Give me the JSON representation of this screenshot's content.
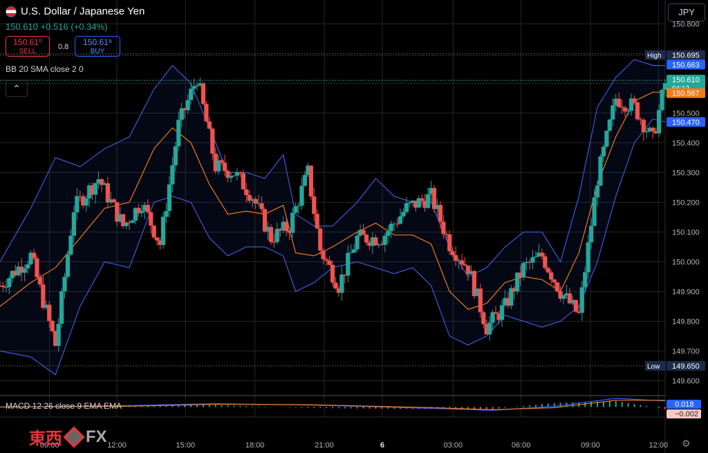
{
  "header": {
    "symbol_name": "U.S. Dollar / Japanese Yen",
    "quote": "150.610 +0.516 (+0.34%)",
    "sell_price": "150.61⁰",
    "sell_label": "SELL",
    "spread": "0.8",
    "buy_price": "150.61⁸",
    "buy_label": "BUY",
    "indicator_label": "BB 20 SMA close 2 0",
    "collapse_icon": "chevron-up-icon",
    "currency_button": "JPY"
  },
  "macd": {
    "label": "MACD 12 26 close 9 EMA EMA",
    "value_tags": [
      {
        "text": "0.018",
        "color": "#2962ff"
      },
      {
        "text": "−0.002",
        "color": "#f7c9c9"
      }
    ]
  },
  "brand": {
    "cjk": "東西",
    "fx": "FX"
  },
  "settings_icon": "gear-icon",
  "colors": {
    "up": "#26a69a",
    "down": "#ef5350",
    "bb_band": "#3d5ad8",
    "bb_basis": "#f07c1a",
    "high_low_tag": "#1e2a4a"
  },
  "chart_data": {
    "type": "candlestick",
    "ylim": [
      149.55,
      150.88
    ],
    "y_ticks": [
      "150.800",
      "150.700",
      "150.600",
      "150.500",
      "150.400",
      "150.300",
      "150.200",
      "150.100",
      "150.000",
      "149.900",
      "149.800",
      "149.700",
      "149.600"
    ],
    "x_ticks": [
      "09:00",
      "12:00",
      "15:00",
      "18:00",
      "21:00",
      "6",
      "03:00",
      "06:00",
      "09:00",
      "12:00"
    ],
    "price_tags": [
      {
        "text": "High",
        "value": "150.695",
        "kind": "high"
      },
      {
        "text": "",
        "value": "150.663",
        "kind": "bb-upper"
      },
      {
        "text": "",
        "value": "150.610",
        "kind": "last",
        "sub": "04:12"
      },
      {
        "text": "",
        "value": "150.567",
        "kind": "bb-basis"
      },
      {
        "text": "",
        "value": "150.500",
        "kind": "plain"
      },
      {
        "text": "",
        "value": "150.470",
        "kind": "bb-lower"
      },
      {
        "text": "Low",
        "value": "149.650",
        "kind": "low"
      }
    ],
    "close_path": [
      [
        0,
        149.92
      ],
      [
        5,
        150.02
      ],
      [
        9,
        149.72
      ],
      [
        12,
        150.18
      ],
      [
        16,
        150.28
      ],
      [
        20,
        150.12
      ],
      [
        23,
        150.2
      ],
      [
        26,
        150.06
      ],
      [
        29,
        150.46
      ],
      [
        32,
        150.62
      ],
      [
        35,
        150.32
      ],
      [
        38,
        150.3
      ],
      [
        41,
        150.22
      ],
      [
        44,
        150.08
      ],
      [
        47,
        150.12
      ],
      [
        50,
        150.3
      ],
      [
        52,
        150.04
      ],
      [
        55,
        149.92
      ],
      [
        58,
        150.08
      ],
      [
        62,
        150.08
      ],
      [
        66,
        150.18
      ],
      [
        70,
        150.22
      ],
      [
        73,
        150.06
      ],
      [
        76,
        149.98
      ],
      [
        79,
        149.78
      ],
      [
        82,
        149.85
      ],
      [
        85,
        149.98
      ],
      [
        88,
        150.02
      ],
      [
        91,
        149.9
      ],
      [
        94,
        149.82
      ],
      [
        97,
        150.28
      ],
      [
        100,
        150.55
      ],
      [
        103,
        150.52
      ],
      [
        106,
        150.41
      ],
      [
        108,
        150.6
      ]
    ],
    "bb_upper": [
      [
        0,
        150.0
      ],
      [
        5,
        150.18
      ],
      [
        9,
        150.35
      ],
      [
        13,
        150.32
      ],
      [
        17,
        150.38
      ],
      [
        21,
        150.42
      ],
      [
        25,
        150.58
      ],
      [
        28,
        150.66
      ],
      [
        31,
        150.6
      ],
      [
        34,
        150.45
      ],
      [
        37,
        150.3
      ],
      [
        40,
        150.3
      ],
      [
        43,
        150.28
      ],
      [
        46,
        150.36
      ],
      [
        48,
        150.16
      ],
      [
        51,
        150.12
      ],
      [
        54,
        150.12
      ],
      [
        58,
        150.2
      ],
      [
        61,
        150.28
      ],
      [
        64,
        150.22
      ],
      [
        67,
        150.2
      ],
      [
        70,
        150.2
      ],
      [
        73,
        150.05
      ],
      [
        76,
        149.95
      ],
      [
        79,
        149.98
      ],
      [
        82,
        150.05
      ],
      [
        85,
        150.1
      ],
      [
        88,
        150.1
      ],
      [
        91,
        150.0
      ],
      [
        94,
        150.22
      ],
      [
        97,
        150.52
      ],
      [
        100,
        150.62
      ],
      [
        103,
        150.68
      ],
      [
        106,
        150.66
      ],
      [
        108,
        150.66
      ]
    ],
    "bb_lower": [
      [
        0,
        149.7
      ],
      [
        5,
        149.68
      ],
      [
        9,
        149.62
      ],
      [
        13,
        149.85
      ],
      [
        17,
        150.0
      ],
      [
        21,
        149.98
      ],
      [
        25,
        150.2
      ],
      [
        28,
        150.22
      ],
      [
        31,
        150.2
      ],
      [
        34,
        150.08
      ],
      [
        37,
        150.02
      ],
      [
        40,
        150.05
      ],
      [
        43,
        150.05
      ],
      [
        46,
        150.02
      ],
      [
        48,
        149.9
      ],
      [
        51,
        149.93
      ],
      [
        54,
        149.98
      ],
      [
        58,
        150.0
      ],
      [
        61,
        149.98
      ],
      [
        64,
        149.96
      ],
      [
        67,
        149.98
      ],
      [
        70,
        149.92
      ],
      [
        73,
        149.75
      ],
      [
        76,
        149.72
      ],
      [
        79,
        149.75
      ],
      [
        82,
        149.82
      ],
      [
        85,
        149.8
      ],
      [
        88,
        149.78
      ],
      [
        91,
        149.8
      ],
      [
        94,
        149.85
      ],
      [
        97,
        150.0
      ],
      [
        100,
        150.22
      ],
      [
        103,
        150.4
      ],
      [
        106,
        150.48
      ],
      [
        108,
        150.47
      ]
    ],
    "bb_basis": [
      [
        0,
        149.85
      ],
      [
        5,
        149.93
      ],
      [
        9,
        149.98
      ],
      [
        13,
        150.08
      ],
      [
        17,
        150.18
      ],
      [
        21,
        150.2
      ],
      [
        25,
        150.38
      ],
      [
        28,
        150.45
      ],
      [
        31,
        150.4
      ],
      [
        34,
        150.26
      ],
      [
        37,
        150.16
      ],
      [
        40,
        150.17
      ],
      [
        43,
        150.16
      ],
      [
        46,
        150.19
      ],
      [
        48,
        150.03
      ],
      [
        51,
        150.02
      ],
      [
        54,
        150.05
      ],
      [
        58,
        150.1
      ],
      [
        61,
        150.13
      ],
      [
        64,
        150.09
      ],
      [
        67,
        150.09
      ],
      [
        70,
        150.06
      ],
      [
        73,
        149.9
      ],
      [
        76,
        149.84
      ],
      [
        79,
        149.86
      ],
      [
        82,
        149.93
      ],
      [
        85,
        149.95
      ],
      [
        88,
        149.94
      ],
      [
        91,
        149.9
      ],
      [
        94,
        150.03
      ],
      [
        97,
        150.26
      ],
      [
        100,
        150.42
      ],
      [
        103,
        150.54
      ],
      [
        106,
        150.57
      ],
      [
        108,
        150.57
      ]
    ],
    "macd_line": [
      [
        0,
        0.0
      ],
      [
        20,
        0.004
      ],
      [
        35,
        0.01
      ],
      [
        50,
        0.006
      ],
      [
        70,
        -0.004
      ],
      [
        80,
        -0.01
      ],
      [
        90,
        0.002
      ],
      [
        100,
        0.026
      ],
      [
        108,
        0.018
      ]
    ],
    "macd_signal": [
      [
        0,
        0.0
      ],
      [
        20,
        0.002
      ],
      [
        35,
        0.008
      ],
      [
        50,
        0.007
      ],
      [
        70,
        -0.002
      ],
      [
        80,
        -0.008
      ],
      [
        90,
        -0.002
      ],
      [
        100,
        0.02
      ],
      [
        108,
        0.02
      ]
    ]
  }
}
